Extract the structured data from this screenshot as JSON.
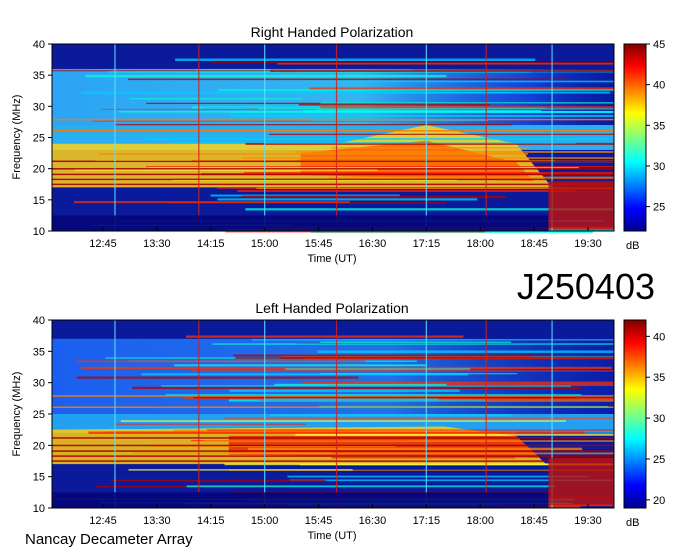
{
  "chart_data": [
    {
      "type": "heatmap",
      "title": "Right Handed Polarization",
      "xlabel": "Time (UT)",
      "ylabel": "Frequency (MHz)",
      "x_ticks": [
        "12:45",
        "13:30",
        "14:15",
        "15:00",
        "15:45",
        "16:30",
        "17:15",
        "18:00",
        "18:45",
        "19:30"
      ],
      "y_ticks": [
        10,
        15,
        20,
        25,
        30,
        35,
        40
      ],
      "ylim": [
        10,
        40
      ],
      "colorbar": {
        "label": "dB",
        "ticks": [
          25,
          30,
          35,
          40,
          45
        ],
        "range": [
          22,
          45
        ]
      },
      "features": {
        "main_emission": "intense band 17-23 MHz through 18:45 rising to 28 MHz near 17:15",
        "high_frequency_edge": "emission fades above ~28 MHz after 17:30",
        "vertical_lines_at": [
          "12:55",
          "14:05",
          "15:00",
          "16:00",
          "17:15",
          "18:05",
          "19:00"
        ]
      }
    },
    {
      "type": "heatmap",
      "title": "Left Handed Polarization",
      "xlabel": "Time (UT)",
      "ylabel": "Frequency (MHz)",
      "x_ticks": [
        "12:45",
        "13:30",
        "14:15",
        "15:00",
        "15:45",
        "16:30",
        "17:15",
        "18:00",
        "18:45",
        "19:30"
      ],
      "y_ticks": [
        10,
        15,
        20,
        25,
        30,
        35,
        40
      ],
      "ylim": [
        10,
        40
      ],
      "colorbar": {
        "label": "dB",
        "ticks": [
          20,
          25,
          30,
          35,
          40
        ],
        "range": [
          19,
          42
        ]
      },
      "features": {
        "main_emission": "intense band 17-22 MHz from 14:30 to 18:45",
        "high_frequency_edge": "weaker emission up to 25 MHz",
        "vertical_lines_at": [
          "12:55",
          "14:05",
          "15:00",
          "16:00",
          "17:15",
          "18:05",
          "19:00"
        ]
      }
    }
  ],
  "labels": {
    "date_code": "J250403",
    "instrument": "Nancay Decameter Array"
  }
}
